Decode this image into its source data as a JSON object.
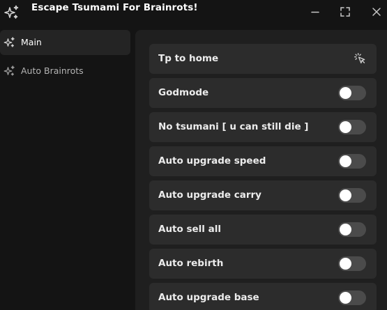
{
  "window": {
    "title": "Escape Tsumami For Brainrots!",
    "icon": "sparkles-icon",
    "controls": [
      "minimize-icon",
      "maximize-icon",
      "close-icon"
    ]
  },
  "sidebar": {
    "items": [
      {
        "label": "Main",
        "icon": "sparkles-icon",
        "active": true
      },
      {
        "label": "Auto Brainrots",
        "icon": "sparkles-icon",
        "active": false
      }
    ]
  },
  "main": {
    "rows": [
      {
        "label": "Tp to home",
        "type": "button",
        "icon": "cursor-click-icon"
      },
      {
        "label": "Godmode",
        "type": "toggle",
        "enabled": false
      },
      {
        "label": "No tsumani [ u can still die ]",
        "type": "toggle",
        "enabled": false
      },
      {
        "label": "Auto upgrade speed",
        "type": "toggle",
        "enabled": false
      },
      {
        "label": "Auto upgrade carry",
        "type": "toggle",
        "enabled": false
      },
      {
        "label": "Auto sell all",
        "type": "toggle",
        "enabled": false
      },
      {
        "label": "Auto rebirth",
        "type": "toggle",
        "enabled": false
      },
      {
        "label": "Auto upgrade base",
        "type": "toggle",
        "enabled": false
      }
    ]
  },
  "colors": {
    "background": "#141414",
    "panel": "#1f1f1f",
    "row": "#2c2c2c",
    "sidebar_active": "#242424",
    "toggle_off": "#4b4b4b"
  }
}
